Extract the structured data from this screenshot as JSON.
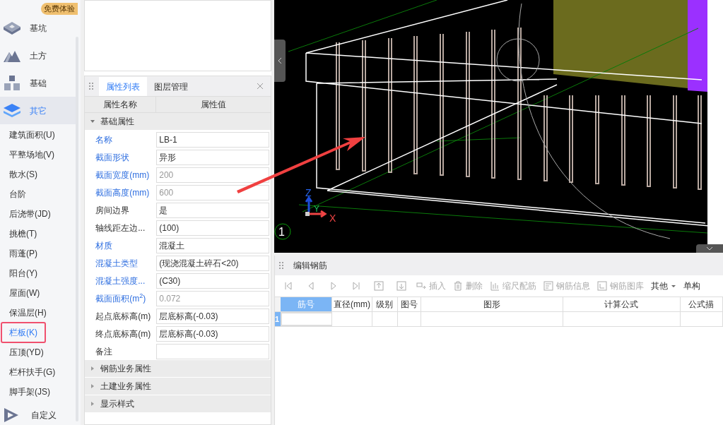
{
  "sidebar": {
    "categories": [
      {
        "label": "基坑",
        "selected": false,
        "badge": "免费体验"
      },
      {
        "label": "土方",
        "selected": false
      },
      {
        "label": "基础",
        "selected": false
      },
      {
        "label": "其它",
        "selected": true
      }
    ],
    "items": [
      {
        "label": "建筑面积(U)",
        "selected": false,
        "marked": false
      },
      {
        "label": "平整场地(V)",
        "selected": false,
        "marked": false
      },
      {
        "label": "散水(S)",
        "selected": false,
        "marked": false
      },
      {
        "label": "台阶",
        "selected": false,
        "marked": false
      },
      {
        "label": "后浇带(JD)",
        "selected": false,
        "marked": false
      },
      {
        "label": "挑檐(T)",
        "selected": false,
        "marked": false
      },
      {
        "label": "雨蓬(P)",
        "selected": false,
        "marked": false
      },
      {
        "label": "阳台(Y)",
        "selected": false,
        "marked": false
      },
      {
        "label": "屋面(W)",
        "selected": false,
        "marked": false
      },
      {
        "label": "保温层(H)",
        "selected": false,
        "marked": false
      },
      {
        "label": "栏板(K)",
        "selected": true,
        "marked": true
      },
      {
        "label": "压顶(YD)",
        "selected": false,
        "marked": false
      },
      {
        "label": "栏杆扶手(G)",
        "selected": false,
        "marked": false
      },
      {
        "label": "脚手架(JS)",
        "selected": false,
        "marked": false
      }
    ],
    "footer": {
      "label": "自定义"
    }
  },
  "properties": {
    "tabs": [
      {
        "label": "属性列表",
        "selected": true
      },
      {
        "label": "图层管理",
        "selected": false
      }
    ],
    "columns": [
      "属性名称",
      "属性值"
    ],
    "groups": [
      {
        "label": "基础属性",
        "expanded": true,
        "rows": [
          {
            "name": "名称",
            "value": "LB-1",
            "blue": true,
            "disabled": false
          },
          {
            "name": "截面形状",
            "value": "异形",
            "blue": true,
            "disabled": false
          },
          {
            "name": "截面宽度(mm)",
            "value": "200",
            "blue": true,
            "disabled": true
          },
          {
            "name": "截面高度(mm)",
            "value": "600",
            "blue": true,
            "disabled": true
          },
          {
            "name": "房间边界",
            "value": "是",
            "blue": false,
            "disabled": false
          },
          {
            "name": "轴线距左边...",
            "value": "(100)",
            "blue": false,
            "disabled": false
          },
          {
            "name": "材质",
            "value": "混凝土",
            "blue": true,
            "disabled": false
          },
          {
            "name": "混凝土类型",
            "value": "(现浇混凝土碎石<20)",
            "blue": true,
            "disabled": false
          },
          {
            "name": "混凝土强度...",
            "value": "(C30)",
            "blue": true,
            "disabled": false
          },
          {
            "name": "截面面积(m$^{2}$)",
            "value": "0.072",
            "blue": true,
            "disabled": true
          },
          {
            "name": "起点底标高(m)",
            "value": "层底标高(-0.03)",
            "blue": false,
            "disabled": false
          },
          {
            "name": "终点底标高(m)",
            "value": "层底标高(-0.03)",
            "blue": false,
            "disabled": false
          },
          {
            "name": "备注",
            "blue": false,
            "disabled": false
          }
        ]
      },
      {
        "label": "钢筋业务属性",
        "expanded": false
      },
      {
        "label": "土建业务属性",
        "expanded": false
      },
      {
        "label": "显示样式",
        "expanded": false
      }
    ]
  },
  "viewport": {
    "axis_labels": [
      "Z",
      "Y",
      "X"
    ],
    "grid_label": "1"
  },
  "rebar": {
    "title": "编辑钢筋",
    "toolbar": [
      {
        "kind": "first",
        "disabled": true
      },
      {
        "kind": "prev",
        "disabled": true
      },
      {
        "kind": "next",
        "disabled": true
      },
      {
        "kind": "last",
        "disabled": true
      },
      {
        "kind": "up",
        "disabled": true
      },
      {
        "kind": "down",
        "disabled": true
      },
      {
        "kind": "insert",
        "label": "插入",
        "disabled": true
      },
      {
        "kind": "delete",
        "label": "删除",
        "disabled": true
      },
      {
        "kind": "scale",
        "label": "缩尺配筋",
        "disabled": true
      },
      {
        "kind": "info",
        "label": "钢筋信息",
        "disabled": true
      },
      {
        "kind": "library",
        "label": "钢筋图库",
        "disabled": true
      },
      {
        "kind": "menu",
        "label": "其他",
        "disabled": false
      },
      {
        "kind": "text",
        "label": "单构",
        "disabled": false
      }
    ],
    "columns": [
      {
        "label": "筋号",
        "selected": true
      },
      {
        "label": "直径(mm)",
        "selected": false
      },
      {
        "label": "级别",
        "selected": false
      },
      {
        "label": "图号",
        "selected": false
      },
      {
        "label": "图形",
        "selected": false
      },
      {
        "label": "计算公式",
        "selected": false
      },
      {
        "label": "公式描",
        "selected": false
      }
    ],
    "rows": [
      "1"
    ]
  }
}
